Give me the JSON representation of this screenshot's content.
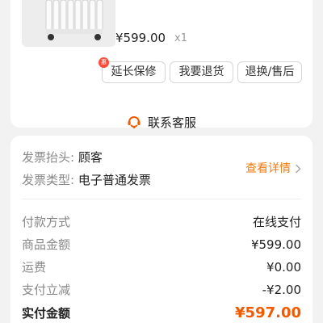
{
  "product": {
    "price": "¥599.00",
    "quantity": "x1"
  },
  "actions": {
    "warranty_tag": "惠",
    "warranty": "延长保修",
    "return": "我要退货",
    "exchange": "退换/售后"
  },
  "customer_service": {
    "label": "联系客服"
  },
  "invoice": {
    "title_label": "发票抬头:",
    "title_value": "顾客",
    "type_label": "发票类型:",
    "type_value": "电子普通发票",
    "details_link": "查看详情"
  },
  "payment": {
    "method_label": "付款方式",
    "method_value": "在线支付",
    "goods_label": "商品金额",
    "goods_value": "¥599.00",
    "shipping_label": "运费",
    "shipping_value": "¥0.00",
    "discount_label": "支付立减",
    "discount_value": "-¥2.00",
    "total_label": "实付金额",
    "total_value": "¥597.00"
  },
  "colors": {
    "accent": "#f25a00",
    "link": "#f07a10",
    "badge": "#ff4a3a"
  }
}
